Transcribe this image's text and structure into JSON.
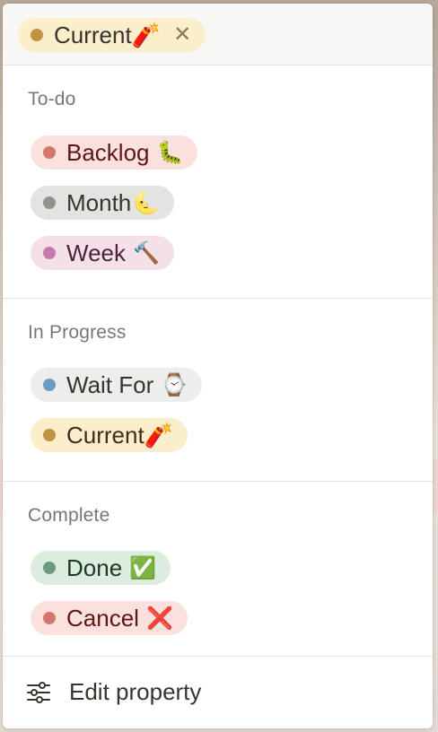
{
  "header": {
    "selected_tag": {
      "label": "Current🧨",
      "dot_color": "#c29243",
      "bg_color": "#fbeecb",
      "remove_glyph": "✕"
    }
  },
  "sections": [
    {
      "title": "To-do",
      "options": [
        {
          "label": "Backlog",
          "emoji": "🐛",
          "dot_color": "#d4776f",
          "bg_color": "#fbe1de",
          "text_color": "#5d1715"
        },
        {
          "label": "Month",
          "emoji": "🌜",
          "dot_color": "#91918e",
          "bg_color": "#e3e3e1",
          "text_color": "#37352f"
        },
        {
          "label": "Week",
          "emoji": "🔨",
          "dot_color": "#c67aa9",
          "bg_color": "#f5e0ea",
          "text_color": "#4c2337"
        }
      ]
    },
    {
      "title": "In Progress",
      "options": [
        {
          "label": "Wait For",
          "emoji": "⌚",
          "dot_color": "#6b9bc6",
          "bg_color": "#ededec",
          "text_color": "#37352f"
        },
        {
          "label": "Current🧨",
          "emoji": "",
          "dot_color": "#c29243",
          "bg_color": "#fbeecb",
          "text_color": "#402c1b"
        }
      ]
    },
    {
      "title": "Complete",
      "options": [
        {
          "label": "Done",
          "emoji": "✅",
          "dot_color": "#6f9a7f",
          "bg_color": "#dcecdd",
          "text_color": "#1c3829"
        },
        {
          "label": "Cancel",
          "emoji": "❌",
          "dot_color": "#d4776f",
          "bg_color": "#fbe1de",
          "text_color": "#5d1715"
        }
      ]
    }
  ],
  "footer": {
    "edit_label": "Edit property",
    "icon": "sliders-icon"
  }
}
